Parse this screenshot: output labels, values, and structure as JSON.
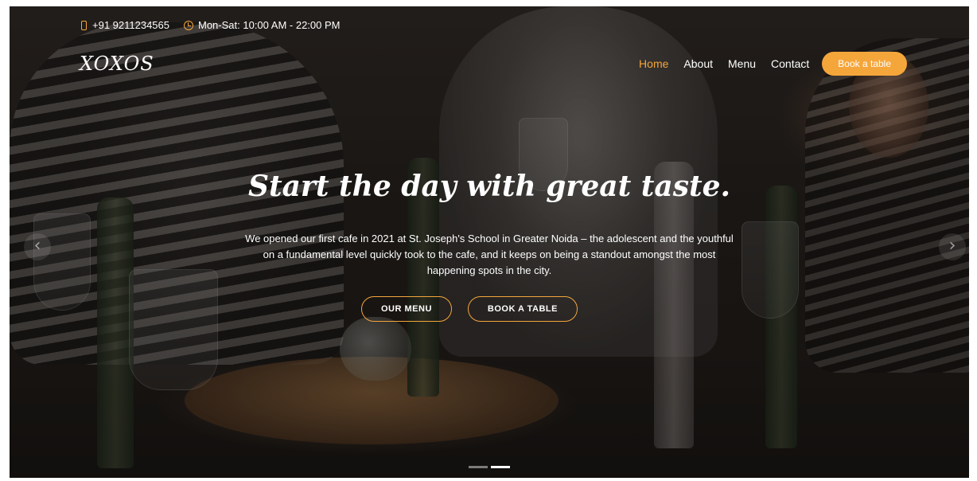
{
  "topbar": {
    "phone": "+91 9211234565",
    "hours": "Mon-Sat: 10:00 AM - 22:00 PM",
    "icons": [
      "phone-icon",
      "clock-icon"
    ]
  },
  "brand": {
    "logo": "XOXOS"
  },
  "nav": {
    "items": [
      "Home",
      "About",
      "Menu",
      "Contact"
    ],
    "active": "Home",
    "cta_label": "Book a table"
  },
  "hero": {
    "headline": "Start the day with great taste.",
    "description": "We opened our first cafe in 2021 at St. Joseph's School in Greater Noida – the adolescent and the youthful on a fundamental level quickly took to the cafe, and it keeps on being a standout amongst the most happening spots in the city.",
    "buttons": {
      "menu": "OUR MENU",
      "book": "BOOK A TABLE"
    }
  },
  "carousel": {
    "prev_icon": "chevron-left-icon",
    "next_icon": "chevron-right-icon",
    "slide_count": 2,
    "active_slide": 2
  },
  "colors": {
    "accent": "#f5a63b",
    "text": "#ffffff"
  }
}
